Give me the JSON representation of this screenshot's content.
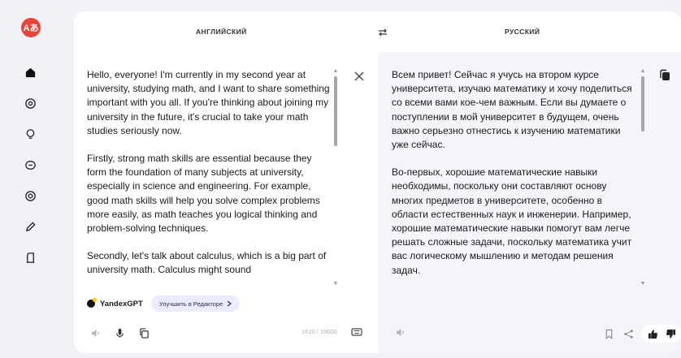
{
  "sidebar": {
    "logo_text": "Aあ",
    "items": [
      {
        "name": "nav-translate",
        "icon": "home-icon"
      },
      {
        "name": "nav-images",
        "icon": "image-icon"
      },
      {
        "name": "nav-ideas",
        "icon": "bulb-icon"
      },
      {
        "name": "nav-chat",
        "icon": "chat-icon"
      },
      {
        "name": "nav-camera",
        "icon": "camera-icon"
      },
      {
        "name": "nav-edit",
        "icon": "pencil-icon"
      },
      {
        "name": "nav-docs",
        "icon": "document-icon"
      }
    ]
  },
  "languages": {
    "source": "АНГЛИЙСКИЙ",
    "target": "РУССКИЙ"
  },
  "source": {
    "paragraphs": [
      "Hello, everyone! I'm currently in my second year at university, studying math, and I want to share something important with you all. If you're thinking about joining my university in the future, it's crucial to take your math studies seriously now.",
      "Firstly, strong math skills are essential because they form the foundation of many subjects at university, especially in science and engineering. For example, good math skills will help you solve complex problems more easily, as math teaches you logical thinking and problem-solving techniques.",
      "Secondly, let's talk about calculus, which is a big part of university math. Calculus might sound"
    ],
    "char_count": "1620 / 10000"
  },
  "target": {
    "paragraphs": [
      "Всем привет! Сейчас я учусь на втором курсе университета, изучаю математику и хочу поделиться со всеми вами кое-чем важным. Если вы думаете о поступлении в мой университет в будущем, очень важно серьезно отнестись к изучению математики уже сейчас.",
      "Во-первых, хорошие математические навыки необходимы, поскольку они составляют основу многих предметов в университете, особенно в области естественных наук и инженерии. Например, хорошие математические навыки помогут вам легче решать сложные задачи, поскольку математика учит вас логическому мышлению и методам решения задач."
    ]
  },
  "gpt": {
    "label": "YandexGPT",
    "improve_button": "Улучшить в Редакторе"
  },
  "colors": {
    "accent": "#e8443a",
    "improve_bg": "#ecebff"
  }
}
